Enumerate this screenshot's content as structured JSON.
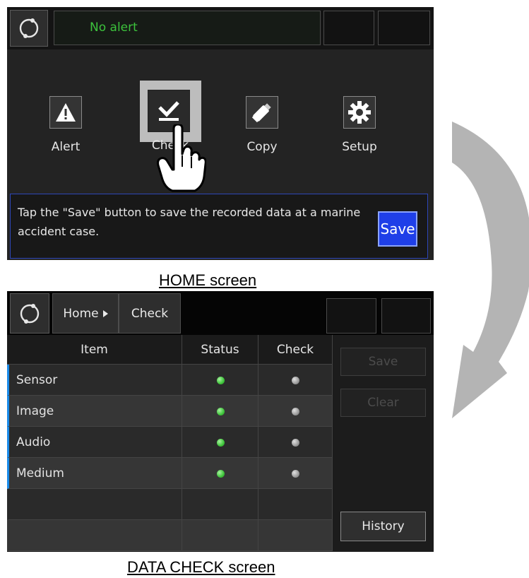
{
  "home": {
    "alert_text": "No alert",
    "menu": [
      {
        "label": "Alert",
        "icon": "warning-icon"
      },
      {
        "label": "Check",
        "icon": "checkmark-icon"
      },
      {
        "label": "Copy",
        "icon": "usb-drive-icon"
      },
      {
        "label": "Setup",
        "icon": "gear-icon"
      }
    ],
    "info_text": "Tap the \"Save\" button to save the recorded data at a marine accident case.",
    "save_label": "Save",
    "caption": "HOME screen"
  },
  "data_check": {
    "breadcrumb": {
      "home": "Home",
      "current": "Check"
    },
    "columns": [
      "Item",
      "Status",
      "Check"
    ],
    "rows": [
      {
        "item": "Sensor",
        "status": "green",
        "check": "gray"
      },
      {
        "item": "Image",
        "status": "green",
        "check": "gray"
      },
      {
        "item": "Audio",
        "status": "green",
        "check": "gray"
      },
      {
        "item": "Medium",
        "status": "green",
        "check": "gray"
      },
      {
        "item": "",
        "status": "",
        "check": ""
      },
      {
        "item": "",
        "status": "",
        "check": ""
      }
    ],
    "buttons": {
      "save": "Save",
      "clear": "Clear",
      "history": "History"
    },
    "caption": "DATA CHECK screen"
  },
  "colors": {
    "alert_green": "#3cc23c",
    "save_blue": "#1f3fe8",
    "row_marker": "#1a8ae8"
  }
}
